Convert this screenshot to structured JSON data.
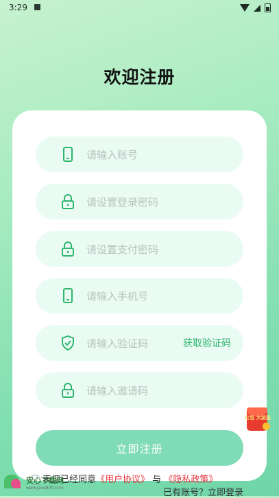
{
  "status_bar": {
    "time": "3:29"
  },
  "title": "欢迎注册",
  "fields": [
    {
      "id": "account",
      "icon": "phone-icon",
      "placeholder": "请输入账号"
    },
    {
      "id": "login-password",
      "icon": "lock-icon",
      "placeholder": "请设置登录密码"
    },
    {
      "id": "pay-password",
      "icon": "lock-icon",
      "placeholder": "请设置支付密码"
    },
    {
      "id": "mobile",
      "icon": "phone-icon",
      "placeholder": "请输入手机号"
    },
    {
      "id": "code",
      "icon": "shield-check-icon",
      "placeholder": "请输入验证码",
      "action": "获取验证码"
    },
    {
      "id": "invite",
      "icon": "lock-icon",
      "placeholder": "请输入邀请码"
    }
  ],
  "register_button": "立即注册",
  "agreement": {
    "prefix": "表您已经同意",
    "user_agreement": "《用户协议》",
    "and": "与",
    "privacy_policy": "《隐私政策》"
  },
  "login_prompt": "已有账号？立即登录",
  "watermark": {
    "title": "安心下载网",
    "url": "www.java800.com"
  },
  "red_packet": {
    "label": "红包 大派送"
  },
  "colors": {
    "accent": "#2fb56e",
    "button": "#7fdcb6",
    "link": "#e8333c",
    "field_bg": "#e9fbf3"
  }
}
